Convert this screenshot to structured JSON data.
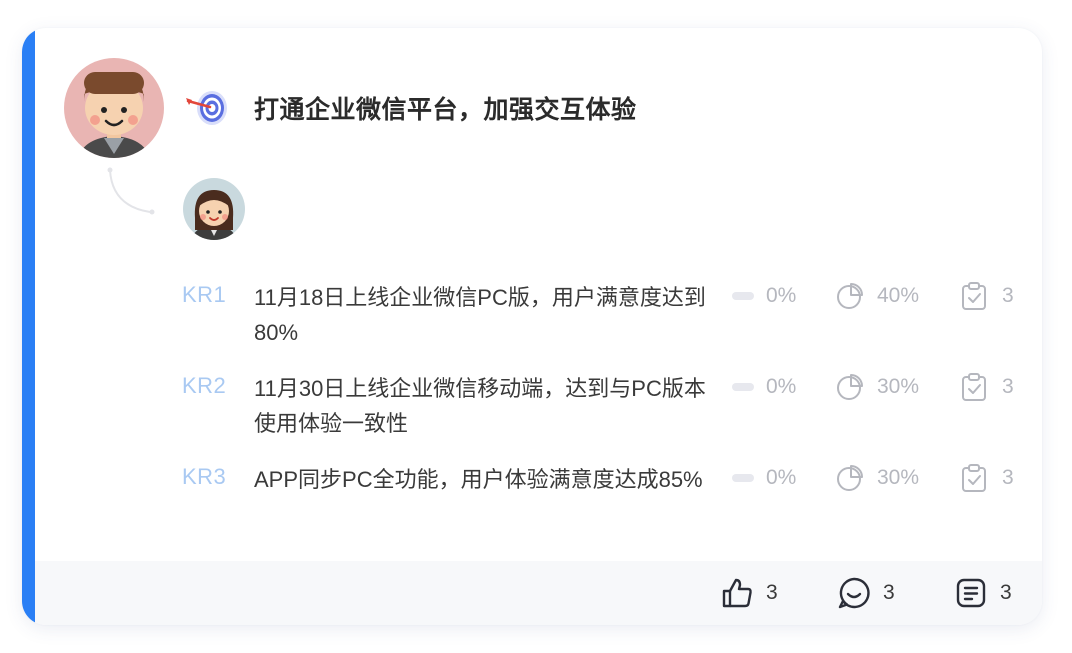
{
  "objective": {
    "title": "打通企业微信平台，加强交互体验",
    "icon": "target-dart-icon"
  },
  "key_results": [
    {
      "tag": "KR1",
      "text": "11月18日上线企业微信PC版，用户满意度达到80%",
      "progress": "0%",
      "confidence": "40%",
      "confidence_fraction": 0.4,
      "task_count": "3"
    },
    {
      "tag": "KR2",
      "text": "11月30日上线企业微信移动端，达到与PC版本使用体验一致性",
      "progress": "0%",
      "confidence": "30%",
      "confidence_fraction": 0.3,
      "task_count": "3"
    },
    {
      "tag": "KR3",
      "text": "APP同步PC全功能，用户体验满意度达成85%",
      "progress": "0%",
      "confidence": "30%",
      "confidence_fraction": 0.3,
      "task_count": "3"
    }
  ],
  "footer": {
    "likes": "3",
    "comments": "3",
    "notes": "3"
  },
  "colors": {
    "accent": "#2a7ff5",
    "kr_tag": "#a9c9f2",
    "muted": "#b5b7be",
    "footer_bg": "#f7f8fa"
  }
}
